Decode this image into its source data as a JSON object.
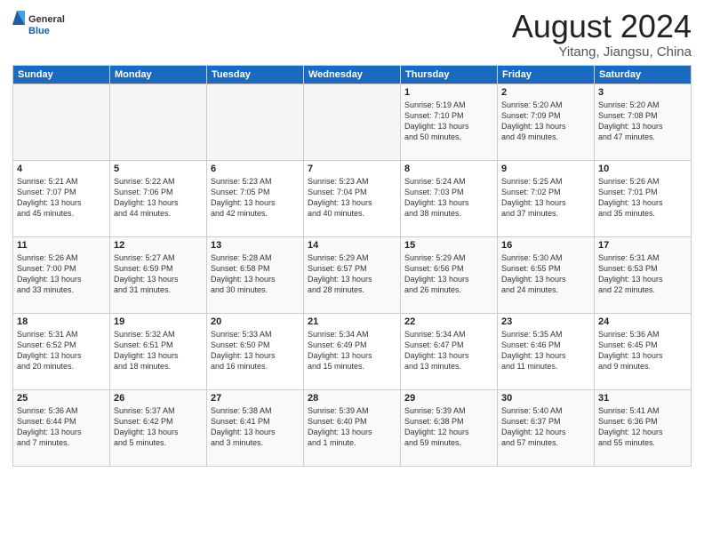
{
  "header": {
    "logo_general": "General",
    "logo_blue": "Blue",
    "title": "August 2024",
    "location": "Yitang, Jiangsu, China"
  },
  "weekdays": [
    "Sunday",
    "Monday",
    "Tuesday",
    "Wednesday",
    "Thursday",
    "Friday",
    "Saturday"
  ],
  "weeks": [
    [
      {
        "day": "",
        "info": ""
      },
      {
        "day": "",
        "info": ""
      },
      {
        "day": "",
        "info": ""
      },
      {
        "day": "",
        "info": ""
      },
      {
        "day": "1",
        "info": "Sunrise: 5:19 AM\nSunset: 7:10 PM\nDaylight: 13 hours\nand 50 minutes."
      },
      {
        "day": "2",
        "info": "Sunrise: 5:20 AM\nSunset: 7:09 PM\nDaylight: 13 hours\nand 49 minutes."
      },
      {
        "day": "3",
        "info": "Sunrise: 5:20 AM\nSunset: 7:08 PM\nDaylight: 13 hours\nand 47 minutes."
      }
    ],
    [
      {
        "day": "4",
        "info": "Sunrise: 5:21 AM\nSunset: 7:07 PM\nDaylight: 13 hours\nand 45 minutes."
      },
      {
        "day": "5",
        "info": "Sunrise: 5:22 AM\nSunset: 7:06 PM\nDaylight: 13 hours\nand 44 minutes."
      },
      {
        "day": "6",
        "info": "Sunrise: 5:23 AM\nSunset: 7:05 PM\nDaylight: 13 hours\nand 42 minutes."
      },
      {
        "day": "7",
        "info": "Sunrise: 5:23 AM\nSunset: 7:04 PM\nDaylight: 13 hours\nand 40 minutes."
      },
      {
        "day": "8",
        "info": "Sunrise: 5:24 AM\nSunset: 7:03 PM\nDaylight: 13 hours\nand 38 minutes."
      },
      {
        "day": "9",
        "info": "Sunrise: 5:25 AM\nSunset: 7:02 PM\nDaylight: 13 hours\nand 37 minutes."
      },
      {
        "day": "10",
        "info": "Sunrise: 5:26 AM\nSunset: 7:01 PM\nDaylight: 13 hours\nand 35 minutes."
      }
    ],
    [
      {
        "day": "11",
        "info": "Sunrise: 5:26 AM\nSunset: 7:00 PM\nDaylight: 13 hours\nand 33 minutes."
      },
      {
        "day": "12",
        "info": "Sunrise: 5:27 AM\nSunset: 6:59 PM\nDaylight: 13 hours\nand 31 minutes."
      },
      {
        "day": "13",
        "info": "Sunrise: 5:28 AM\nSunset: 6:58 PM\nDaylight: 13 hours\nand 30 minutes."
      },
      {
        "day": "14",
        "info": "Sunrise: 5:29 AM\nSunset: 6:57 PM\nDaylight: 13 hours\nand 28 minutes."
      },
      {
        "day": "15",
        "info": "Sunrise: 5:29 AM\nSunset: 6:56 PM\nDaylight: 13 hours\nand 26 minutes."
      },
      {
        "day": "16",
        "info": "Sunrise: 5:30 AM\nSunset: 6:55 PM\nDaylight: 13 hours\nand 24 minutes."
      },
      {
        "day": "17",
        "info": "Sunrise: 5:31 AM\nSunset: 6:53 PM\nDaylight: 13 hours\nand 22 minutes."
      }
    ],
    [
      {
        "day": "18",
        "info": "Sunrise: 5:31 AM\nSunset: 6:52 PM\nDaylight: 13 hours\nand 20 minutes."
      },
      {
        "day": "19",
        "info": "Sunrise: 5:32 AM\nSunset: 6:51 PM\nDaylight: 13 hours\nand 18 minutes."
      },
      {
        "day": "20",
        "info": "Sunrise: 5:33 AM\nSunset: 6:50 PM\nDaylight: 13 hours\nand 16 minutes."
      },
      {
        "day": "21",
        "info": "Sunrise: 5:34 AM\nSunset: 6:49 PM\nDaylight: 13 hours\nand 15 minutes."
      },
      {
        "day": "22",
        "info": "Sunrise: 5:34 AM\nSunset: 6:47 PM\nDaylight: 13 hours\nand 13 minutes."
      },
      {
        "day": "23",
        "info": "Sunrise: 5:35 AM\nSunset: 6:46 PM\nDaylight: 13 hours\nand 11 minutes."
      },
      {
        "day": "24",
        "info": "Sunrise: 5:36 AM\nSunset: 6:45 PM\nDaylight: 13 hours\nand 9 minutes."
      }
    ],
    [
      {
        "day": "25",
        "info": "Sunrise: 5:36 AM\nSunset: 6:44 PM\nDaylight: 13 hours\nand 7 minutes."
      },
      {
        "day": "26",
        "info": "Sunrise: 5:37 AM\nSunset: 6:42 PM\nDaylight: 13 hours\nand 5 minutes."
      },
      {
        "day": "27",
        "info": "Sunrise: 5:38 AM\nSunset: 6:41 PM\nDaylight: 13 hours\nand 3 minutes."
      },
      {
        "day": "28",
        "info": "Sunrise: 5:39 AM\nSunset: 6:40 PM\nDaylight: 13 hours\nand 1 minute."
      },
      {
        "day": "29",
        "info": "Sunrise: 5:39 AM\nSunset: 6:38 PM\nDaylight: 12 hours\nand 59 minutes."
      },
      {
        "day": "30",
        "info": "Sunrise: 5:40 AM\nSunset: 6:37 PM\nDaylight: 12 hours\nand 57 minutes."
      },
      {
        "day": "31",
        "info": "Sunrise: 5:41 AM\nSunset: 6:36 PM\nDaylight: 12 hours\nand 55 minutes."
      }
    ]
  ]
}
